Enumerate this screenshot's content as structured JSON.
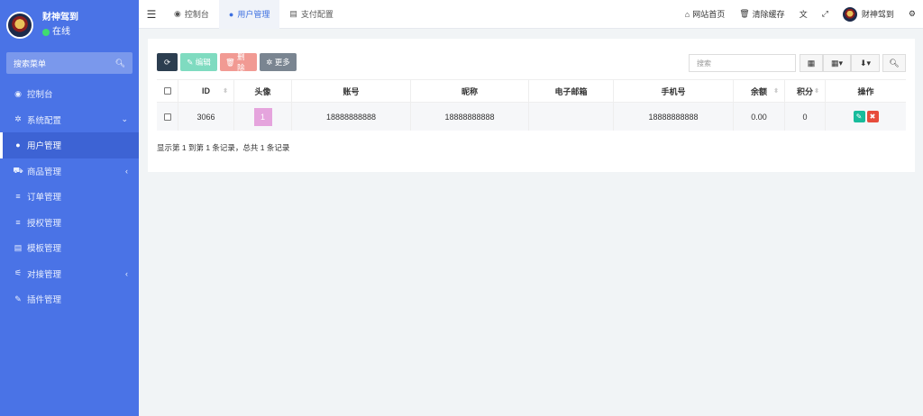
{
  "sidebar": {
    "username": "财神驾到",
    "status": "在线",
    "search_placeholder": "搜索菜单",
    "search_icon": "search-icon",
    "items": [
      {
        "label": "控制台",
        "icon": "dashboard-icon",
        "arrow": ""
      },
      {
        "label": "系统配置",
        "icon": "gear-icon",
        "arrow": "⌄"
      },
      {
        "label": "用户管理",
        "icon": "user-icon",
        "arrow": "",
        "active": true
      },
      {
        "label": "商品管理",
        "icon": "cart-icon",
        "arrow": "‹"
      },
      {
        "label": "订单管理",
        "icon": "list-icon",
        "arrow": ""
      },
      {
        "label": "授权管理",
        "icon": "list-icon",
        "arrow": ""
      },
      {
        "label": "模板管理",
        "icon": "template-icon",
        "arrow": ""
      },
      {
        "label": "对接管理",
        "icon": "sliders-icon",
        "arrow": "‹"
      },
      {
        "label": "插件管理",
        "icon": "plug-icon",
        "arrow": ""
      }
    ]
  },
  "topbar": {
    "tabs": [
      {
        "label": "控制台",
        "icon": "dashboard-icon"
      },
      {
        "label": "用户管理",
        "icon": "user-icon",
        "active": true
      },
      {
        "label": "支付配置",
        "icon": "table-icon"
      }
    ],
    "site_home": "网站首页",
    "clear_cache": "清除缓存",
    "username": "财神驾到"
  },
  "toolbar": {
    "edit_label": "编辑",
    "delete_label": "删除",
    "more_label": "更多",
    "search_placeholder": "搜索"
  },
  "table": {
    "columns": [
      "ID",
      "头像",
      "账号",
      "昵称",
      "电子邮箱",
      "手机号",
      "余额",
      "积分",
      "操作"
    ],
    "rows": [
      {
        "id": "3066",
        "avatar": "1",
        "account": "18888888888",
        "nickname": "18888888888",
        "email": "",
        "phone": "18888888888",
        "balance": "0.00",
        "points": "0"
      }
    ],
    "summary": "显示第 1 到第 1 条记录，总共 1 条记录"
  },
  "colors": {
    "sidebar_bg": "#4a73e6",
    "accent": "#3c6fe0",
    "edit_green": "#18bc9c",
    "delete_red": "#e74c3c"
  }
}
